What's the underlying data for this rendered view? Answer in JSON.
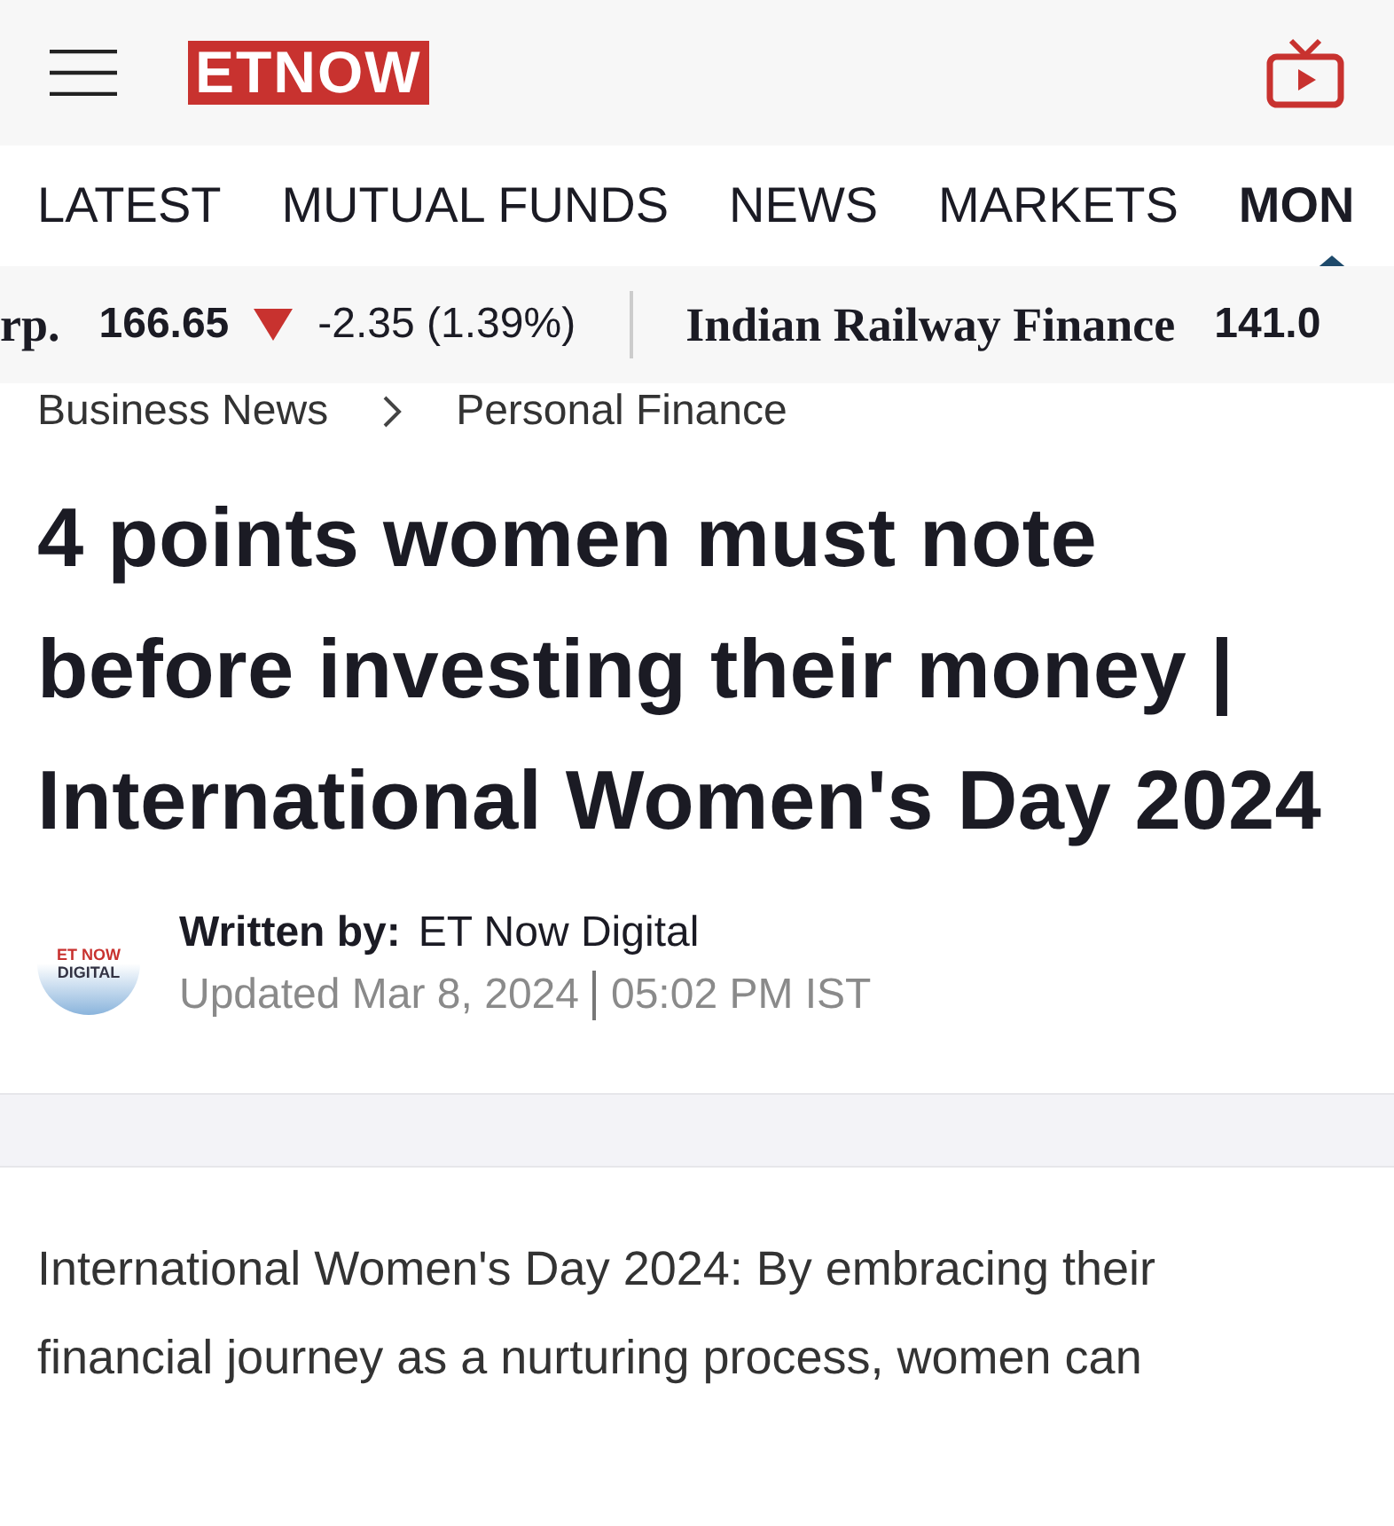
{
  "header": {
    "logo": "ETNOW"
  },
  "nav": {
    "tabs": [
      {
        "label": "LATEST",
        "selected": false
      },
      {
        "label": "MUTUAL FUNDS",
        "selected": false
      },
      {
        "label": "NEWS",
        "selected": false
      },
      {
        "label": "MARKETS",
        "selected": false
      },
      {
        "label": "MON",
        "selected": true
      }
    ]
  },
  "ticker": [
    {
      "name": "rp.",
      "price": "166.65",
      "down": true,
      "change": "-2.35 (1.39%)"
    },
    {
      "name": "Indian Railway Finance",
      "price": "141.0"
    }
  ],
  "breadcrumb": [
    "Business News",
    "Personal Finance"
  ],
  "article": {
    "title": "4 points women must note before investing their money | International Women's Day 2024",
    "author": {
      "avatar_lines": [
        "ET NOW",
        "DIGITAL"
      ],
      "label": "Written by:",
      "name": "ET Now Digital",
      "updated": "Updated Mar 8, 2024",
      "time": "05:02 PM IST"
    },
    "body": "International Women's Day 2024: By embracing their financial journey as a nurturing process, women can"
  }
}
